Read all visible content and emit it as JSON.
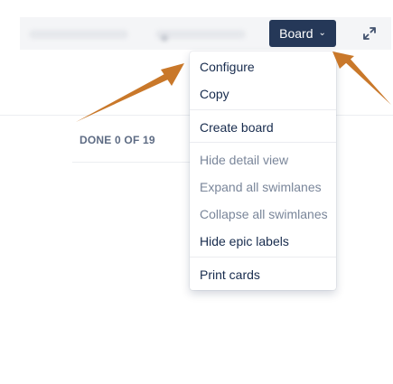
{
  "toolbar": {
    "board_label": "Board",
    "board_chevron": "chevron-down-icon",
    "expand_icon": "expand-icon"
  },
  "column": {
    "done_label": "DONE 0 OF 19"
  },
  "menu": {
    "items": [
      {
        "label": "Configure",
        "muted": false
      },
      {
        "label": "Copy",
        "muted": false
      },
      {
        "label": "Create board",
        "muted": false
      },
      {
        "label": "Hide detail view",
        "muted": true
      },
      {
        "label": "Expand all swimlanes",
        "muted": true
      },
      {
        "label": "Collapse all swimlanes",
        "muted": true
      },
      {
        "label": "Hide epic labels",
        "muted": false
      },
      {
        "label": "Print cards",
        "muted": false
      }
    ]
  },
  "colors": {
    "accent": "#253858",
    "arrow": "#c9782a",
    "muted_text": "#7a869a"
  }
}
